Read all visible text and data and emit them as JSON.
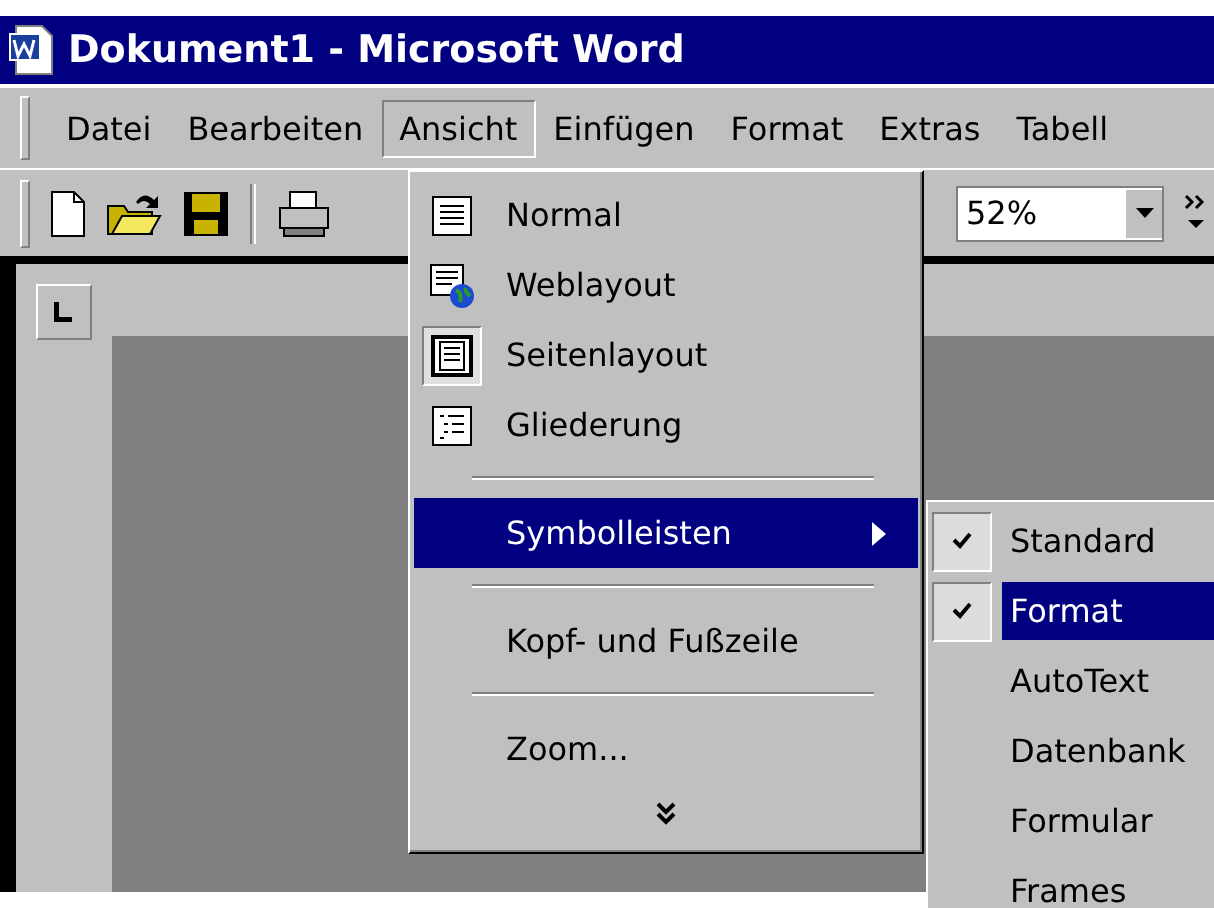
{
  "window": {
    "title": "Dokument1 - Microsoft Word"
  },
  "menu_bar": [
    {
      "label": "Datei",
      "selected": false
    },
    {
      "label": "Bearbeiten",
      "selected": false
    },
    {
      "label": "Ansicht",
      "selected": true
    },
    {
      "label": "Einfügen",
      "selected": false
    },
    {
      "label": "Format",
      "selected": false
    },
    {
      "label": "Extras",
      "selected": false
    },
    {
      "label": "Tabell",
      "selected": false
    }
  ],
  "toolbar": {
    "zoom": "52%"
  },
  "view_menu": [
    {
      "kind": "item",
      "label": "Normal",
      "selected": false
    },
    {
      "kind": "item",
      "label": "Weblayout",
      "selected": false
    },
    {
      "kind": "item",
      "label": "Seitenlayout",
      "selected": true
    },
    {
      "kind": "item",
      "label": "Gliederung",
      "selected": false
    },
    {
      "kind": "separator"
    },
    {
      "kind": "submenu",
      "label": "Symbolleisten",
      "selected": true
    },
    {
      "kind": "separator"
    },
    {
      "kind": "item",
      "label": "Kopf- und Fußzeile",
      "selected": false
    },
    {
      "kind": "separator"
    },
    {
      "kind": "item",
      "label": "Zoom...",
      "selected": false
    },
    {
      "kind": "more"
    }
  ],
  "toolbars_submenu": [
    {
      "label": "Standard",
      "checked": true,
      "selected": false
    },
    {
      "label": "Format",
      "checked": true,
      "selected": true
    },
    {
      "label": "AutoText",
      "checked": false,
      "selected": false
    },
    {
      "label": "Datenbank",
      "checked": false,
      "selected": false
    },
    {
      "label": "Formular",
      "checked": false,
      "selected": false
    },
    {
      "label": "Frames",
      "checked": false,
      "selected": false
    }
  ]
}
